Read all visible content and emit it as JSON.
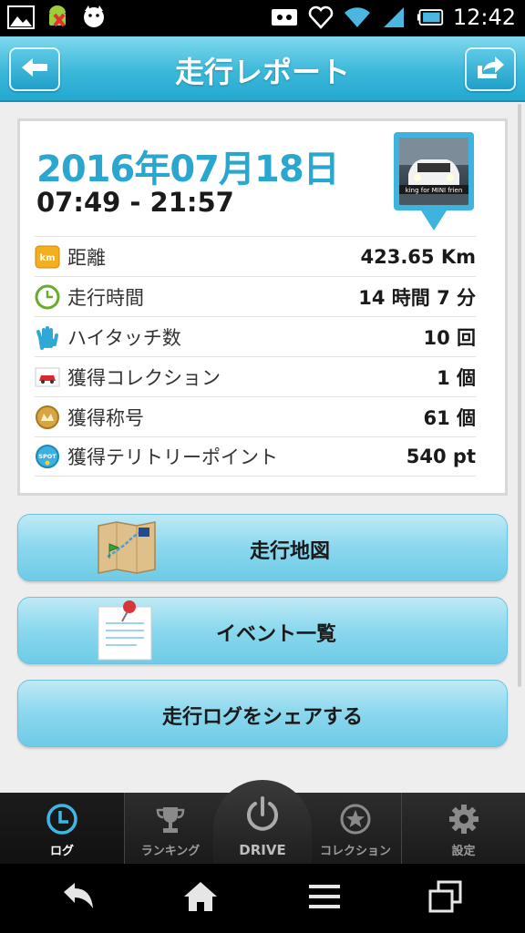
{
  "status_bar": {
    "time": "12:42",
    "icons": [
      "gallery-icon",
      "android-icon",
      "dog-icon",
      "cassette-icon",
      "heart-icon",
      "wifi-icon",
      "signal-icon",
      "battery-icon"
    ]
  },
  "header": {
    "title": "走行レポート",
    "back_icon": "arrow-left-icon",
    "share_icon": "share-arrow-icon"
  },
  "report": {
    "date": "2016年07月18日",
    "time_range": "07:49 - 21:57",
    "avatar_caption": "king for MINI frien",
    "stats": [
      {
        "icon": "km-badge-icon",
        "label": "距離",
        "value": "423.65 Km"
      },
      {
        "icon": "clock-icon",
        "label": "走行時間",
        "value": "14 時間 7 分"
      },
      {
        "icon": "hand-icon",
        "label": "ハイタッチ数",
        "value": "10 回"
      },
      {
        "icon": "car-icon",
        "label": "獲得コレクション",
        "value": "1 個"
      },
      {
        "icon": "medal-icon",
        "label": "獲得称号",
        "value": "61 個"
      },
      {
        "icon": "spot-icon",
        "label": "獲得テリトリーポイント",
        "value": "540 pt"
      }
    ]
  },
  "actions": {
    "map_label": "走行地図",
    "event_label": "イベント一覧",
    "share_label": "走行ログをシェアする"
  },
  "tabs": {
    "log": "ログ",
    "ranking": "ランキング",
    "drive": "DRIVE",
    "collection": "コレクション",
    "settings": "設定"
  },
  "colors": {
    "accent": "#2aa7cf",
    "header": "#3bb8da",
    "button": "#8ad7ee"
  }
}
